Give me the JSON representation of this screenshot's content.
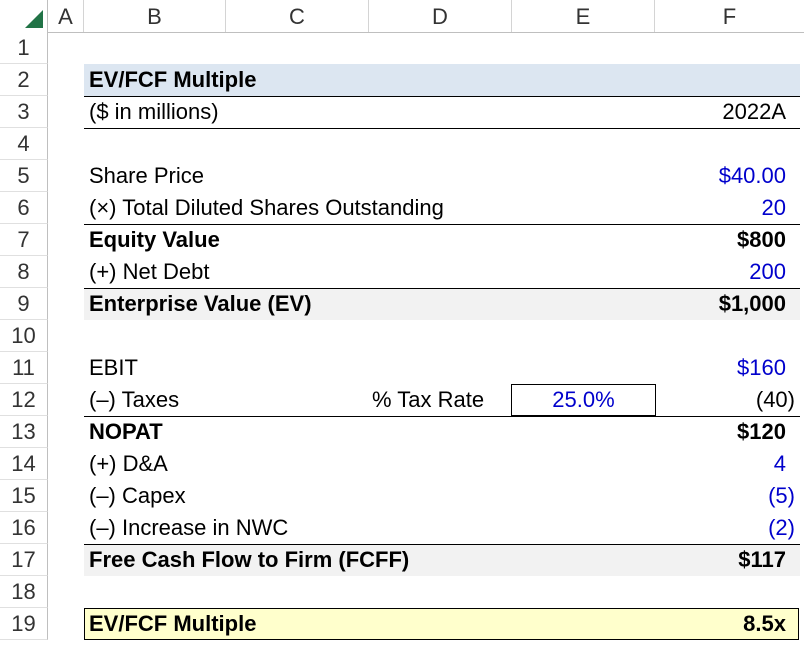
{
  "columns": [
    "A",
    "B",
    "C",
    "D",
    "E",
    "F"
  ],
  "rows": [
    "1",
    "2",
    "3",
    "4",
    "5",
    "6",
    "7",
    "8",
    "9",
    "10",
    "11",
    "12",
    "13",
    "14",
    "15",
    "16",
    "17",
    "18",
    "19"
  ],
  "title": "EV/FCF Multiple",
  "units": "($ in millions)",
  "period": "2022A",
  "share_price": {
    "label": "Share Price",
    "value": "$40.00"
  },
  "diluted_shares": {
    "label": "(×) Total Diluted Shares Outstanding",
    "value": "20"
  },
  "equity_value": {
    "label": "Equity Value",
    "value": "$800"
  },
  "net_debt": {
    "label": "(+) Net Debt",
    "value": "200"
  },
  "enterprise_value": {
    "label": "Enterprise Value (EV)",
    "value": "$1,000"
  },
  "ebit": {
    "label": "EBIT",
    "value": "$160"
  },
  "taxes": {
    "label": "(–) Taxes",
    "rate_label": "% Tax Rate",
    "rate_value": "25.0%",
    "value": "(40)"
  },
  "nopat": {
    "label": "NOPAT",
    "value": "$120"
  },
  "da": {
    "label": "(+) D&A",
    "value": "4"
  },
  "capex": {
    "label": "(–) Capex",
    "value": "(5)"
  },
  "nwc": {
    "label": "(–) Increase in NWC",
    "value": "(2)"
  },
  "fcff": {
    "label": "Free Cash Flow to Firm (FCFF)",
    "value": "$117"
  },
  "multiple": {
    "label": "EV/FCF Multiple",
    "value": "8.5x"
  },
  "colors": {
    "title_band": "#dce6f1",
    "total_band": "#f2f2f2",
    "result_band": "#ffffcc",
    "input_text": "#0000cc",
    "excel_green": "#217346"
  }
}
